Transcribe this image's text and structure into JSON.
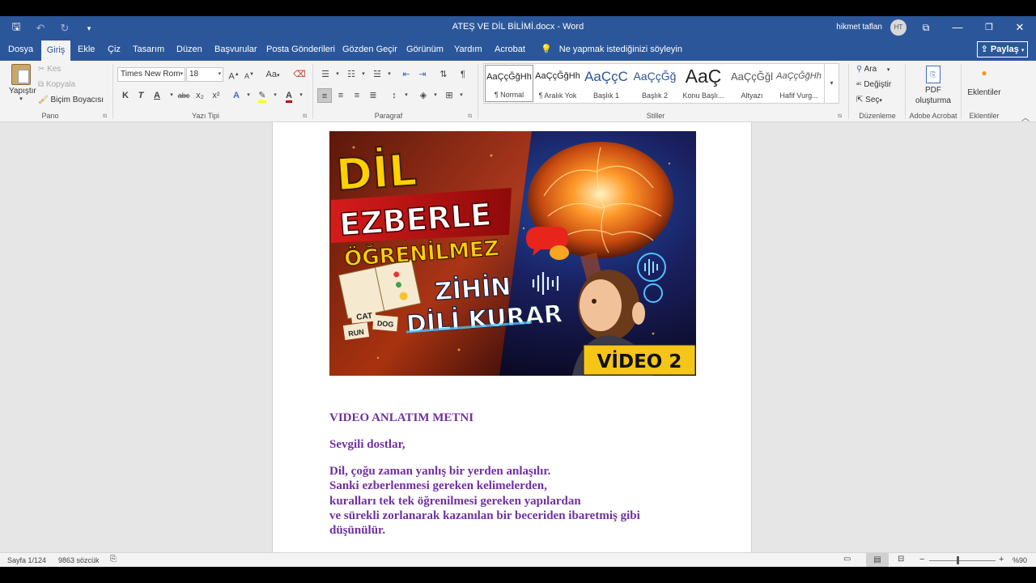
{
  "window": {
    "title": "ATEŞ VE DİL BİLİMİ.docx  -  Word",
    "user_name": "hikmet taflan",
    "user_initials": "HT"
  },
  "tabs": [
    {
      "label": "Dosya"
    },
    {
      "label": "Giriş"
    },
    {
      "label": "Ekle"
    },
    {
      "label": "Çiz"
    },
    {
      "label": "Tasarım"
    },
    {
      "label": "Düzen"
    },
    {
      "label": "Başvurular"
    },
    {
      "label": "Posta Gönderileri"
    },
    {
      "label": "Gözden Geçir"
    },
    {
      "label": "Görünüm"
    },
    {
      "label": "Yardım"
    },
    {
      "label": "Acrobat"
    }
  ],
  "tell_me": "Ne yapmak istediğinizi söyleyin",
  "share_label": "Paylaş",
  "ribbon": {
    "clipboard": {
      "paste": "Yapıştır",
      "cut": "Kes",
      "copy": "Kopyala",
      "format_painter": "Biçim Boyacısı",
      "label": "Pano"
    },
    "font": {
      "name": "Times New Rom",
      "size": "18",
      "label": "Yazı Tipi",
      "bold": "K",
      "italic": "T",
      "underline": "A",
      "strike": "abc",
      "subscript": "x₂",
      "superscript": "x²",
      "case": "Aa",
      "grow": "A",
      "shrink": "A"
    },
    "paragraph": {
      "label": "Paragraf"
    },
    "styles": {
      "label": "Stiller",
      "items": [
        {
          "sample": "AaÇçĞğHh",
          "name": "¶ Normal"
        },
        {
          "sample": "AaÇçĞğHh",
          "name": "¶ Aralık Yok"
        },
        {
          "sample": "AaÇçC",
          "name": "Başlık 1"
        },
        {
          "sample": "AaÇçĞğ",
          "name": "Başlık 2"
        },
        {
          "sample": "AaÇ",
          "name": "Konu Başlı..."
        },
        {
          "sample": "AaÇçĞğl",
          "name": "Altyazı"
        },
        {
          "sample": "AaÇçĞğHh",
          "name": "Hafif Vurg..."
        }
      ]
    },
    "editing": {
      "find": "Ara",
      "replace": "Değiştir",
      "select": "Seç",
      "label": "Düzenleme"
    },
    "acrobat": {
      "pdf_line1": "PDF",
      "pdf_line2": "oluşturma",
      "label": "Adobe Acrobat"
    },
    "addins": {
      "button": "Eklentiler",
      "label": "Eklentiler"
    }
  },
  "thumbnail": {
    "line1": "DİL",
    "line2": "EZBERLE",
    "line3": "ÖĞRENİLMEZ",
    "line4": "ZİHİN",
    "line5": "DİLİ KURAR",
    "badge": "VİDEO 2",
    "tag_cat": "CAT",
    "tag_dog": "DOG",
    "tag_run": "RUN"
  },
  "document": {
    "heading": "VIDEO ANLATIM METNI",
    "greeting": "Sevgili dostlar,",
    "paragraph": [
      "Dil, çoğu zaman yanlış bir yerden anlaşılır.",
      "Sanki ezberlenmesi gereken kelimelerden,",
      "kuralları tek tek öğrenilmesi gereken yapılardan",
      "ve sürekli zorlanarak kazanılan bir beceriden ibaretmiş gibi",
      "düşünülür."
    ]
  },
  "status": {
    "page": "Sayfa 1/124",
    "words": "9863 sözcük",
    "zoom": "%90"
  },
  "colors": {
    "word_blue": "#2b579a",
    "text_purple": "#7030a0",
    "badge_yellow": "#f5c518"
  }
}
